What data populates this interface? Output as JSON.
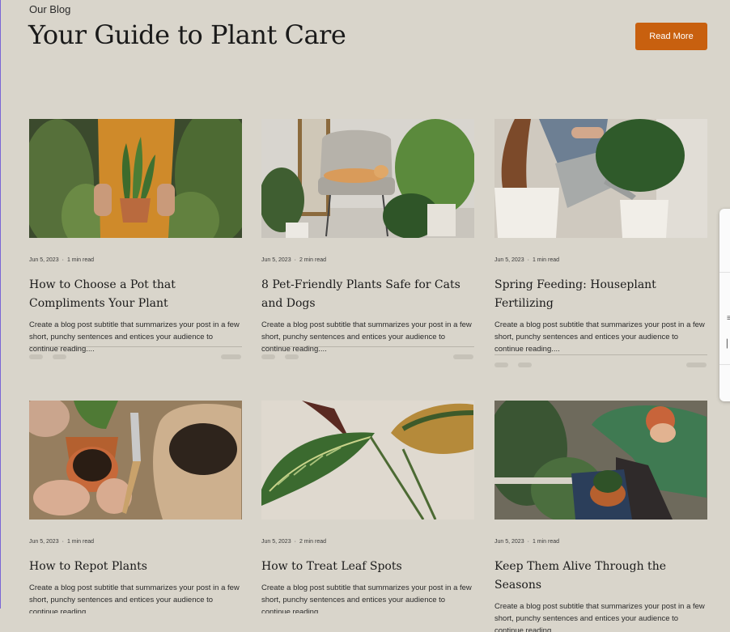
{
  "header": {
    "eyebrow": "Our Blog",
    "title": "Your Guide to Plant Care",
    "read_more_label": "Read More"
  },
  "colors": {
    "background": "#d9d5cb",
    "accent": "#c8600f"
  },
  "posts": [
    {
      "date": "Jun 5, 2023",
      "read_time": "1 min read",
      "title": "How to Choose a Pot that Compliments Your Plant",
      "excerpt": "Create a blog post subtitle that summarizes your post in a few short, punchy sentences and entices your audience to continue reading....",
      "image": "woman holding snake plant in pot"
    },
    {
      "date": "Jun 5, 2023",
      "read_time": "2 min read",
      "title": "8 Pet-Friendly Plants Safe for Cats and Dogs",
      "excerpt": "Create a blog post subtitle that summarizes your post in a few short, punchy sentences and entices your audience to continue reading....",
      "image": "dog resting on chair among plants"
    },
    {
      "date": "Jun 5, 2023",
      "read_time": "1 min read",
      "title": "Spring Feeding: Houseplant Fertilizing",
      "excerpt": "Create a blog post subtitle that summarizes your post in a few short, punchy sentences and entices your audience to continue reading....",
      "image": "watering can over potted plants"
    },
    {
      "date": "Jun 5, 2023",
      "read_time": "1 min read",
      "title": "How to Repot Plants",
      "excerpt": "Create a blog post subtitle that summarizes your post in a few short, punchy sentences and entices your audience to continue reading....",
      "image": "hands repotting with soil"
    },
    {
      "date": "Jun 5, 2023",
      "read_time": "2 min read",
      "title": "How to Treat Leaf Spots",
      "excerpt": "Create a blog post subtitle that summarizes your post in a few short, punchy sentences and entices your audience to continue reading....",
      "image": "calathea leaves closeup"
    },
    {
      "date": "Jun 5, 2023",
      "read_time": "1 min read",
      "title": "Keep Them Alive Through the Seasons",
      "excerpt": "Create a blog post subtitle that summarizes your post in a few short, punchy sentences and entices your audience to continue reading....",
      "image": "man tending plants in greenhouse"
    }
  ]
}
